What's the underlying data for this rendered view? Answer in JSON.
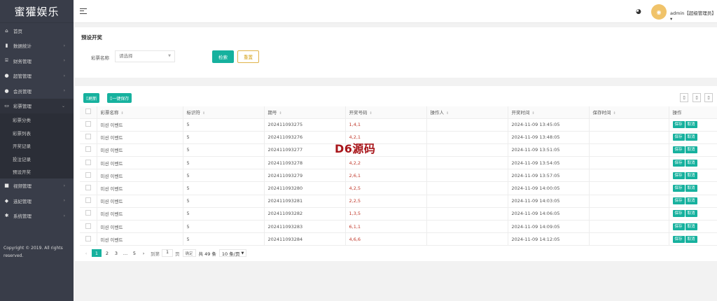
{
  "app": {
    "logo": "蜜獾娱乐"
  },
  "sidebar": {
    "items": [
      {
        "icon": "home-icon",
        "glyph": "⌂",
        "label": "首页",
        "arrow": ""
      },
      {
        "icon": "chart-icon",
        "glyph": "▮",
        "label": "数据统计",
        "arrow": "›"
      },
      {
        "icon": "bank-icon",
        "glyph": "⌸",
        "label": "财务管理",
        "arrow": "›"
      },
      {
        "icon": "user-icon",
        "glyph": "●",
        "label": "超管管理",
        "arrow": "›"
      },
      {
        "icon": "users-icon",
        "glyph": "●",
        "label": "会员管理",
        "arrow": "›"
      },
      {
        "icon": "ticket-icon",
        "glyph": "▭",
        "label": "彩票管理",
        "arrow": "⌄"
      },
      {
        "icon": "video-icon",
        "glyph": "■",
        "label": "视频管理",
        "arrow": "›"
      },
      {
        "icon": "gamepad-icon",
        "glyph": "◆",
        "label": "选妃管理",
        "arrow": "›"
      },
      {
        "icon": "gear-icon",
        "glyph": "✱",
        "label": "系统管理",
        "arrow": "›"
      }
    ],
    "sub_items": [
      "彩票分类",
      "彩票列表",
      "开奖记录",
      "投注记录",
      "预设开奖"
    ],
    "copyright": "Copyright © 2019. All rights reserved."
  },
  "header": {
    "menu_icon": "menu-icon",
    "palette_icon": "palette-icon",
    "user": "admin【超级管理员】",
    "user_caret": "▾"
  },
  "filter": {
    "title": "预设开奖",
    "label": "彩票名称",
    "placeholder": "请选择",
    "search_label": "检索",
    "reset_label": "重置"
  },
  "toolbar": {
    "refresh_label": "刷新",
    "save_all_label": "一键保存"
  },
  "table": {
    "columns": [
      "彩票名称",
      "标识符",
      "期号",
      "开奖号码",
      "操作人",
      "开奖时间",
      "保存时间",
      "操作"
    ],
    "save_label": "保存",
    "cancel_label": "取消",
    "rows": [
      {
        "name": "미션 이벤트",
        "id": "5",
        "issue": "202411093275",
        "code": "1,4,1",
        "op": "",
        "time": "2024-11-09 13:45:05",
        "saved": ""
      },
      {
        "name": "미션 이벤트",
        "id": "5",
        "issue": "202411093276",
        "code": "4,2,1",
        "op": "",
        "time": "2024-11-09 13:48:05",
        "saved": ""
      },
      {
        "name": "미션 이벤트",
        "id": "5",
        "issue": "202411093277",
        "code": "2,3,5",
        "op": "",
        "time": "2024-11-09 13:51:05",
        "saved": ""
      },
      {
        "name": "미션 이벤트",
        "id": "5",
        "issue": "202411093278",
        "code": "4,2,2",
        "op": "",
        "time": "2024-11-09 13:54:05",
        "saved": ""
      },
      {
        "name": "미션 이벤트",
        "id": "5",
        "issue": "202411093279",
        "code": "2,6,1",
        "op": "",
        "time": "2024-11-09 13:57:05",
        "saved": ""
      },
      {
        "name": "미션 이벤트",
        "id": "5",
        "issue": "202411093280",
        "code": "4,2,5",
        "op": "",
        "time": "2024-11-09 14:00:05",
        "saved": ""
      },
      {
        "name": "미션 이벤트",
        "id": "5",
        "issue": "202411093281",
        "code": "2,2,5",
        "op": "",
        "time": "2024-11-09 14:03:05",
        "saved": ""
      },
      {
        "name": "미션 이벤트",
        "id": "5",
        "issue": "202411093282",
        "code": "1,3,5",
        "op": "",
        "time": "2024-11-09 14:06:05",
        "saved": ""
      },
      {
        "name": "미션 이벤트",
        "id": "5",
        "issue": "202411093283",
        "code": "6,1,1",
        "op": "",
        "time": "2024-11-09 14:09:05",
        "saved": ""
      },
      {
        "name": "미션 이벤트",
        "id": "5",
        "issue": "202411093284",
        "code": "4,6,6",
        "op": "",
        "time": "2024-11-09 14:12:05",
        "saved": ""
      }
    ]
  },
  "pager": {
    "prev": "‹",
    "pages": [
      "1",
      "2",
      "3",
      "…",
      "5"
    ],
    "next": "›",
    "goto_label": "到第",
    "goto_value": "1",
    "page_unit": "页",
    "confirm_label": "确定",
    "total": "共 49 条",
    "page_size": "10 条/页"
  },
  "watermark": "D6源码",
  "colors": {
    "accent": "#16b19e",
    "sidebar": "#393d49",
    "code": "#c0392b"
  }
}
